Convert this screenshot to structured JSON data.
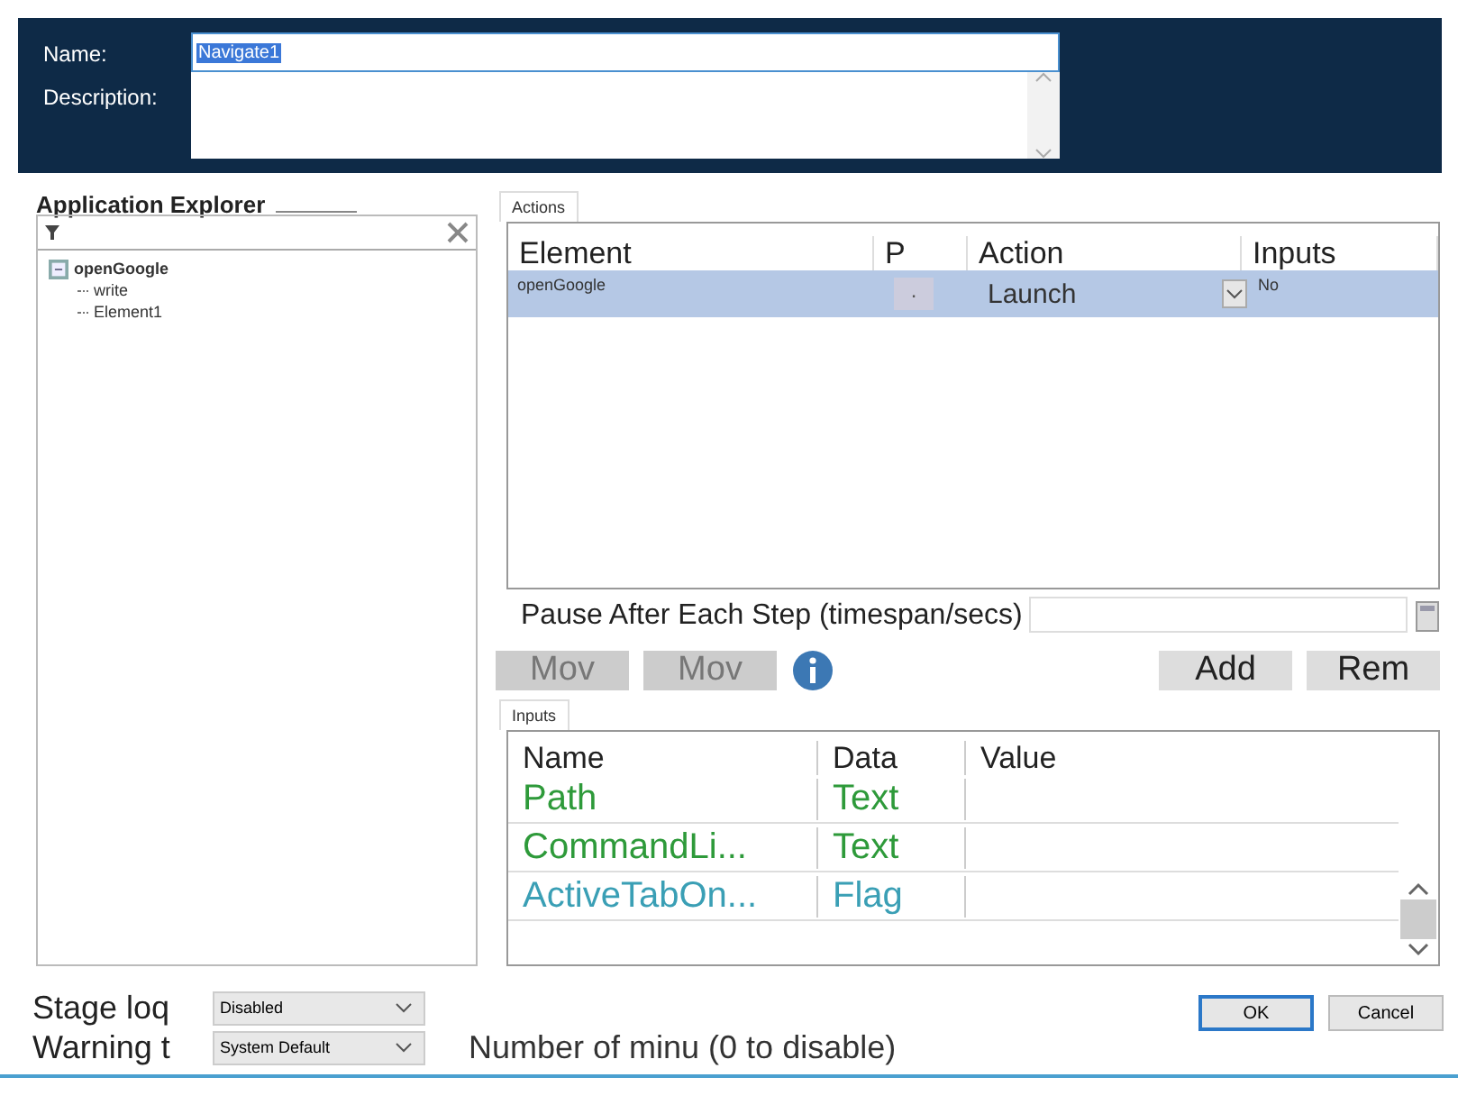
{
  "header": {
    "name_label": "Name:",
    "name_value": "Navigate1",
    "description_label": "Description:"
  },
  "explorer": {
    "title": "Application Explorer",
    "tree": [
      {
        "label": "openGoogle",
        "expanded": true,
        "children": [
          {
            "label": "write"
          },
          {
            "label": "Element1"
          }
        ]
      }
    ]
  },
  "actions": {
    "tab": "Actions",
    "columns": [
      "Element",
      "P",
      "Action",
      "Inputs"
    ],
    "rows": [
      {
        "element": "openGoogle",
        "p": ".",
        "action": "Launch",
        "inputs": "No",
        "selected": true
      }
    ],
    "pause_label": "Pause After Each Step (timespan/secs)"
  },
  "buttons_left": [
    {
      "label": "Mov",
      "disabled": true
    },
    {
      "label": "Mov",
      "disabled": true
    }
  ],
  "buttons_right": [
    {
      "label": "Add",
      "disabled": false
    },
    {
      "label": "Rem",
      "disabled": false
    }
  ],
  "inputs": {
    "tab": "Inputs",
    "columns": [
      "Name",
      "Data",
      "Value"
    ],
    "rows": [
      {
        "name": "Path",
        "data": "Text",
        "color": "#2e9a3a"
      },
      {
        "name": "CommandLi...",
        "data": "Text",
        "color": "#2e9a3a"
      },
      {
        "name": "ActiveTabOn...",
        "data": "Flag",
        "color": "#3a9fb5"
      }
    ]
  },
  "footer": {
    "stage_label": "Stage loq",
    "stage_value": "Disabled",
    "warning_label": "Warning t",
    "warning_value": "System Default",
    "minutes_label": "Number of minu (0 to disable)",
    "ok": "OK",
    "cancel": "Cancel"
  }
}
